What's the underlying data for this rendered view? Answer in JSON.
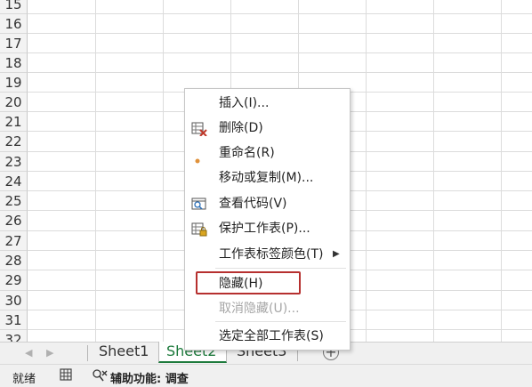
{
  "rows": [
    "15",
    "16",
    "17",
    "18",
    "19",
    "20",
    "21",
    "22",
    "23",
    "24",
    "25",
    "26",
    "27",
    "28",
    "29",
    "30",
    "31",
    "32"
  ],
  "sheet_tabs": [
    {
      "label": "Sheet1",
      "active": false
    },
    {
      "label": "Sheet2",
      "active": true
    },
    {
      "label": "Sheet3",
      "active": false
    }
  ],
  "status_bar": {
    "ready": "就绪",
    "accessibility": "辅助功能: 调查"
  },
  "context_menu": {
    "items": [
      {
        "label": "插入(I)...",
        "icon": null,
        "enabled": true
      },
      {
        "label": "删除(D)",
        "icon": "delete-sheet-icon",
        "enabled": true
      },
      {
        "label": "重命名(R)",
        "icon": "bullet-icon",
        "enabled": true
      },
      {
        "label": "移动或复制(M)...",
        "icon": null,
        "enabled": true
      },
      {
        "label": "查看代码(V)",
        "icon": "view-code-icon",
        "enabled": true
      },
      {
        "label": "保护工作表(P)...",
        "icon": "protect-sheet-icon",
        "enabled": true
      },
      {
        "label": "工作表标签颜色(T)",
        "icon": null,
        "enabled": true,
        "submenu": true
      },
      {
        "label": "隐藏(H)",
        "icon": null,
        "enabled": true,
        "highlighted": true
      },
      {
        "label": "取消隐藏(U)...",
        "icon": null,
        "enabled": false
      },
      {
        "label": "选定全部工作表(S)",
        "icon": null,
        "enabled": true
      }
    ]
  },
  "colors": {
    "active_tab": "#1d7a3c",
    "highlight_box": "#b6302f"
  }
}
